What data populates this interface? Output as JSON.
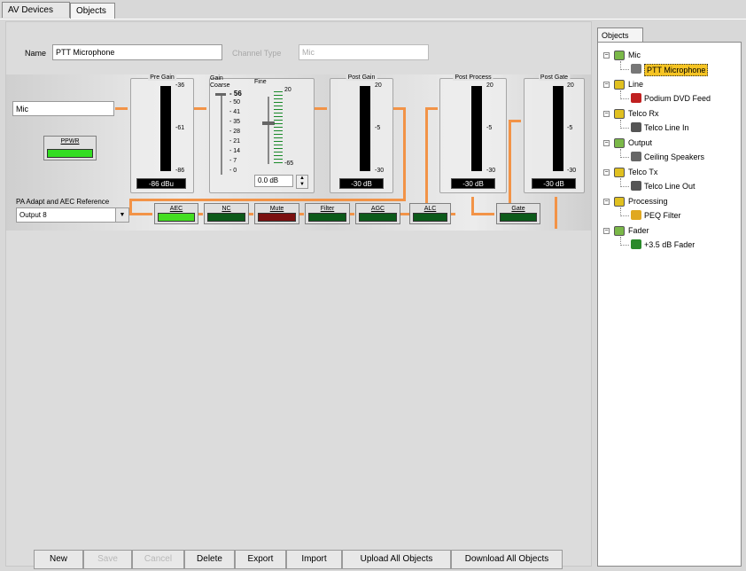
{
  "tabs": [
    {
      "label": "AV Devices"
    },
    {
      "label": "Objects"
    }
  ],
  "form": {
    "name_label": "Name",
    "name_value": "PTT Microphone",
    "channel_type_label": "Channel Type",
    "channel_type_value": "Mic"
  },
  "strip": {
    "input_value": "Mic",
    "ppwr_label": "PPWR",
    "pre_gain": {
      "title": "Pre Gain",
      "ticks": [
        "-36",
        "-61",
        "-86"
      ],
      "readout": "-86 dBu"
    },
    "gain": {
      "title": "Gain",
      "coarse_label": "Coarse",
      "fine_label": "Fine",
      "coarse_ticks": [
        "- 56",
        "- 50",
        "- 41",
        "- 35",
        "- 28",
        "- 21",
        "- 14",
        "- 7",
        "- 0"
      ],
      "fine_ticks": [
        "20",
        "-65"
      ],
      "fine_value": "0.0 dB"
    },
    "post_gain": {
      "title": "Post Gain",
      "ticks": [
        "20",
        "-5",
        "-30"
      ],
      "readout": "-30 dB"
    },
    "post_process": {
      "title": "Post Process",
      "ticks": [
        "20",
        "-5",
        "-30"
      ],
      "readout": "-30 dB"
    },
    "post_gate": {
      "title": "Post Gate",
      "ticks": [
        "20",
        "-5",
        "-30"
      ],
      "readout": "-30 dB"
    },
    "reference_label": "PA Adapt and AEC Reference",
    "reference_value": "Output 8",
    "blocks": [
      {
        "label": "AEC",
        "led": "#44dd22"
      },
      {
        "label": "NC",
        "led": "#0c5a1a"
      },
      {
        "label": "Mute",
        "led": "#7a1010"
      },
      {
        "label": "Filter",
        "led": "#0c5a1a"
      },
      {
        "label": "AGC",
        "led": "#0c5a1a"
      },
      {
        "label": "ALC",
        "led": "#0c5a1a"
      },
      {
        "label": "Gate",
        "led": "#0c5a1a"
      }
    ],
    "ppwr_led": "#33dd22",
    "wire_color": "#f29347"
  },
  "buttons": [
    {
      "label": "New",
      "enabled": true
    },
    {
      "label": "Save",
      "enabled": false
    },
    {
      "label": "Cancel",
      "enabled": false
    },
    {
      "label": "Delete",
      "enabled": true
    },
    {
      "label": "Export",
      "enabled": true
    },
    {
      "label": "Import",
      "enabled": true
    },
    {
      "label": "Upload All Objects",
      "enabled": true
    },
    {
      "label": "Download All Objects",
      "enabled": true
    }
  ],
  "tree": {
    "tab_label": "Objects",
    "groups": [
      {
        "label": "Mic",
        "icon": "mic-group-icon",
        "child": "PTT Microphone",
        "child_icon": "microphone-icon",
        "selected": true
      },
      {
        "label": "Line",
        "icon": "line-group-icon",
        "child": "Podium DVD Feed",
        "child_icon": "line-input-icon"
      },
      {
        "label": "Telco Rx",
        "icon": "telco-rx-group-icon",
        "child": "Telco Line In",
        "child_icon": "telco-rx-icon"
      },
      {
        "label": "Output",
        "icon": "output-group-icon",
        "child": "Ceiling Speakers",
        "child_icon": "speaker-icon"
      },
      {
        "label": "Telco Tx",
        "icon": "telco-tx-group-icon",
        "child": "Telco Line Out",
        "child_icon": "telco-tx-icon"
      },
      {
        "label": "Processing",
        "icon": "processing-group-icon",
        "child": "PEQ Filter",
        "child_icon": "peq-filter-icon"
      },
      {
        "label": "Fader",
        "icon": "fader-group-icon",
        "child": "+3.5 dB Fader",
        "child_icon": "fader-icon"
      }
    ]
  }
}
